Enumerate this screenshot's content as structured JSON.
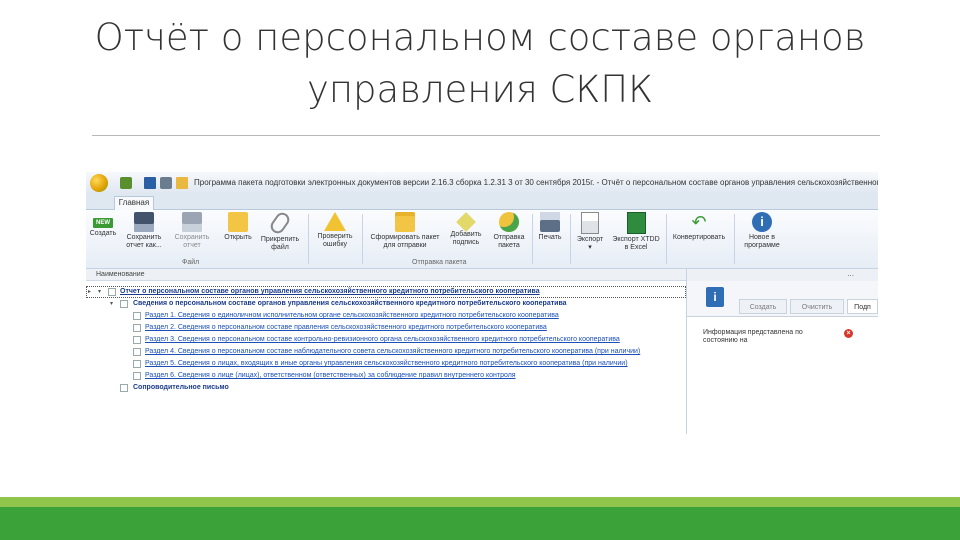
{
  "slide": {
    "title": "Отчёт о персональном составе органов управления СКПК"
  },
  "app": {
    "window_title": "Программа пакета подготовки электронных документов версии 2.16.3 сборка 1.2.31 3 от 30 сентября 2015г. - Отчёт о персональном составе органов управления сельскохозяйственного к",
    "active_tab": "Главная",
    "ribbon": {
      "buttons": [
        {
          "icon": "new-icon",
          "label": "Создать"
        },
        {
          "icon": "save-icon",
          "label": "Сохранить\nотчет как..."
        },
        {
          "icon": "save-report-icon",
          "label": "Сохранить\nотчет"
        },
        {
          "icon": "open-folder-icon",
          "label": "Открыть"
        },
        {
          "icon": "attach-icon",
          "label": "Прикрепить\nфайл"
        },
        {
          "icon": "warning-icon",
          "label": "Проверить\nошибку"
        },
        {
          "icon": "package-folder-icon",
          "label": "Сформировать пакет\nдля отправки"
        },
        {
          "icon": "add-sign-icon",
          "label": "Добавить\nподпись"
        },
        {
          "icon": "send-icon",
          "label": "Отправка\nпакета"
        },
        {
          "icon": "print-icon",
          "label": "Печать"
        },
        {
          "icon": "export-icon",
          "label": "Экспорт\n▾"
        },
        {
          "icon": "excel-icon",
          "label": "Экспорт XTDD\nв Excel"
        },
        {
          "icon": "convert-icon",
          "label": "Конвертировать"
        },
        {
          "icon": "info-icon",
          "label": "Новое в\nпрограмме"
        }
      ],
      "groups": [
        "Файл",
        "Отправка пакета"
      ]
    },
    "tree": {
      "header": "Наименование",
      "rows": [
        {
          "kind": "root",
          "text": "Отчет о персональном составе органов управления сельскохозяйственного кредитного потребительского кооператива"
        },
        {
          "kind": "section",
          "text": "Сведения о персональном составе органов управления сельскохозяйственного кредитного потребительского кооператива"
        },
        {
          "kind": "leaf",
          "text": "Раздел 1. Сведения о единоличном исполнительном органе сельскохозяйственного кредитного потребительского кооператива"
        },
        {
          "kind": "leaf",
          "text": "Раздел 2. Сведения о персональном составе правления сельскохозяйственного кредитного потребительского кооператива"
        },
        {
          "kind": "leaf",
          "text": "Раздел 3. Сведения о персональном составе контрольно-ревизионного органа сельскохозяйственного кредитного потребительского кооператива"
        },
        {
          "kind": "leaf",
          "text": "Раздел 4. Сведения о персональном составе наблюдательного совета сельскохозяйственного кредитного потребительского кооператива (при наличии)"
        },
        {
          "kind": "leaf",
          "text": "Раздел 5. Сведения о лицах, входящих в иные органы управления сельскохозяйственного кредитного потребительского кооператива (при наличии)"
        },
        {
          "kind": "leaf",
          "text": "Раздел 6. Сведения о лице (лицах), ответственном (ответственных) за соблюдение правил внутреннего контроля"
        },
        {
          "kind": "letter",
          "text": "Сопроводительное письмо"
        }
      ]
    },
    "panel": {
      "dots": "...",
      "buttons": [
        "Создать",
        "Очистить",
        "Подп"
      ],
      "info_text": "Информация представлена по состоянию на"
    }
  }
}
